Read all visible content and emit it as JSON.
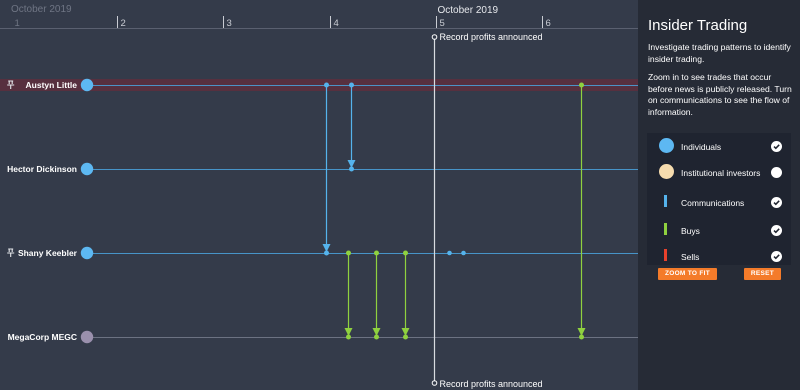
{
  "timeline": {
    "top_axis": {
      "major_label": "October 2019",
      "day_ticks": [
        "1",
        "2",
        "3",
        "4",
        "5",
        "6"
      ]
    },
    "marker_month_label": "October 2019",
    "event": {
      "label": "Record profits announced"
    },
    "nodes": [
      {
        "id": "austyn",
        "label": "Austyn Little",
        "type": "individual",
        "pinned": true,
        "highlighted": true,
        "color": "#5db8f2"
      },
      {
        "id": "hector",
        "label": "Hector Dickinson",
        "type": "individual",
        "pinned": false,
        "highlighted": false,
        "color": "#5db8f2"
      },
      {
        "id": "shany",
        "label": "Shany Keebler",
        "type": "individual",
        "pinned": true,
        "highlighted": false,
        "color": "#5db8f2"
      },
      {
        "id": "megacorp",
        "label": "MegaCorp MEGC",
        "type": "company",
        "pinned": false,
        "highlighted": false,
        "color": "#9a90ad"
      }
    ],
    "day_range": [
      0.9,
      6.9
    ],
    "event_day": 4.98,
    "communications": [
      {
        "from": "austyn",
        "to": "shany",
        "day": 3.97
      },
      {
        "from": "austyn",
        "to": "hector",
        "day": 4.2
      }
    ],
    "buys": [
      {
        "from": "shany",
        "to": "megacorp",
        "day": 4.17
      },
      {
        "from": "shany",
        "to": "megacorp",
        "day": 4.44
      },
      {
        "from": "shany",
        "to": "megacorp",
        "day": 4.71
      },
      {
        "from": "austyn",
        "to": "megacorp",
        "day": 6.36
      }
    ],
    "activity_points": [
      {
        "node": "shany",
        "day": 5.12
      },
      {
        "node": "shany",
        "day": 5.25
      }
    ],
    "colors": {
      "communication": "#55b3ec",
      "buy": "#8fd13f",
      "sell": "#e8412c",
      "institutional": "#f6dcae",
      "highlight_band": "#5e2f3d"
    }
  },
  "panel": {
    "title": "Insider Trading",
    "description": [
      "Investigate trading patterns to identify insider trading.",
      "Zoom in to see trades that occur before news is publicly released. Turn on communications to see the flow of information."
    ],
    "legend": [
      {
        "label": "Individuals",
        "swatch": "circle",
        "color": "#5db8f2",
        "checked": true
      },
      {
        "label": "Institutional investors",
        "swatch": "circle",
        "color": "#f6dcae",
        "checked": false
      },
      {
        "label": "Communications",
        "swatch": "bar",
        "color": "#55b3ec",
        "checked": true
      },
      {
        "label": "Buys",
        "swatch": "bar",
        "color": "#8fd13f",
        "checked": true
      },
      {
        "label": "Sells",
        "swatch": "bar",
        "color": "#e8412c",
        "checked": true
      }
    ],
    "buttons": {
      "zoom_to_fit": "ZOOM TO FIT",
      "reset": "RESET"
    }
  }
}
